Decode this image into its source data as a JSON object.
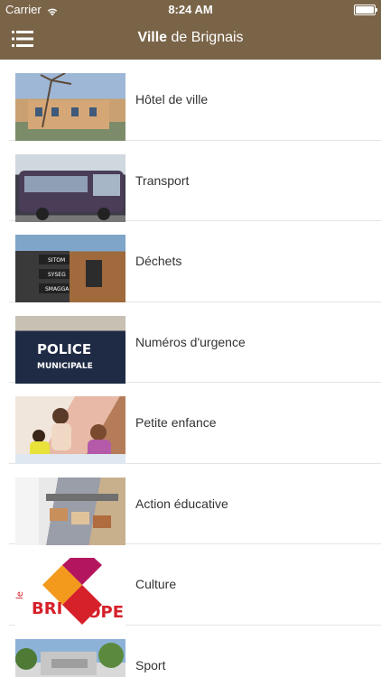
{
  "status": {
    "carrier": "Carrier",
    "time": "8:24 AM"
  },
  "header": {
    "title_bold": "Ville",
    "title_rest": " de Brignais"
  },
  "items": [
    {
      "label": "Hôtel de ville"
    },
    {
      "label": "Transport"
    },
    {
      "label": "Déchets",
      "thumb_text": [
        "SITOM",
        "SYSEG",
        "SMAGGA"
      ]
    },
    {
      "label": "Numéros d'urgence",
      "thumb_text": [
        "POLICE",
        "MUNICIPALE"
      ]
    },
    {
      "label": "Petite enfance"
    },
    {
      "label": "Action éducative"
    },
    {
      "label": "Culture",
      "thumb_text": [
        "le",
        "BRI",
        "COPE"
      ]
    },
    {
      "label": "Sport"
    }
  ],
  "colors": {
    "header": "#7a6448",
    "text": "#333333",
    "culture_red": "#d6202a",
    "culture_orange": "#f39a1c",
    "culture_magenta": "#b4155f"
  }
}
